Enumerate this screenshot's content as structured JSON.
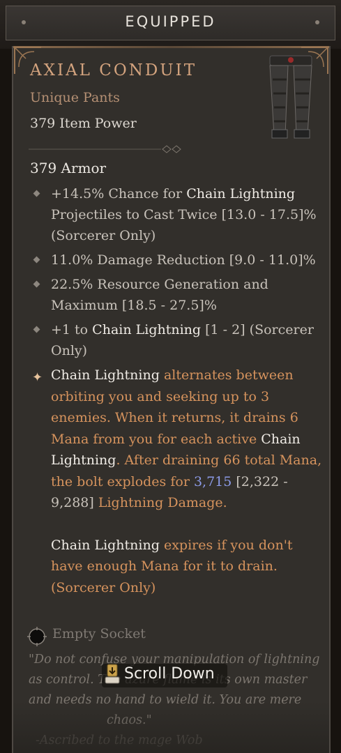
{
  "header": {
    "title": "EQUIPPED"
  },
  "item": {
    "name": "AXIAL CONDUIT",
    "type": "Unique Pants",
    "power": "379 Item Power",
    "armor": "379 Armor",
    "image_icon": "pants-icon"
  },
  "affixes": [
    {
      "pre": "+14.5% Chance for ",
      "hl": "Chain Lightning",
      "post": " Projectiles to Cast Twice [13.0 - 17.5]% (Sorcerer Only)"
    },
    {
      "pre": "11.0% Damage Reduction [9.0 - 11.0]%",
      "hl": "",
      "post": ""
    },
    {
      "pre": "22.5% Resource Generation and Maximum [18.5 - 27.5]%",
      "hl": "",
      "post": ""
    },
    {
      "pre": "+1 to ",
      "hl": "Chain Lightning",
      "post": " [1 - 2] (Sorcerer Only)"
    }
  ],
  "unique_power": {
    "p1": "Chain Lightning",
    "p2": " alternates between orbiting you and seeking up to 3 enemies. When it returns, it drains 6 Mana from you for each active ",
    "p3": "Chain Lightning",
    "p4": ". After draining 66 total Mana, the bolt explodes for ",
    "p5": "3,715",
    "p6": " [2,322 - 9,288]",
    "p7": " Lightning Damage.",
    "p8": "Chain Lightning",
    "p9": " expires if you don't have enough Mana for it to drain. (Sorcerer Only)"
  },
  "socket": {
    "label": "Empty Socket"
  },
  "flavor": {
    "text": "\"Do not confuse your manipulation of lightning as control. The azure flame is its own master and needs no hand to wield it. You are mere",
    "hidden_tail": "chaos.\"",
    "attribution": "-Ascribed to the mage Wob"
  },
  "scroll": {
    "label": "Scroll Down"
  },
  "colors": {
    "unique_name": "#d3a37e",
    "unique_text": "#d6935d",
    "value_blue": "#8c9be8",
    "background": "#322f2b"
  }
}
